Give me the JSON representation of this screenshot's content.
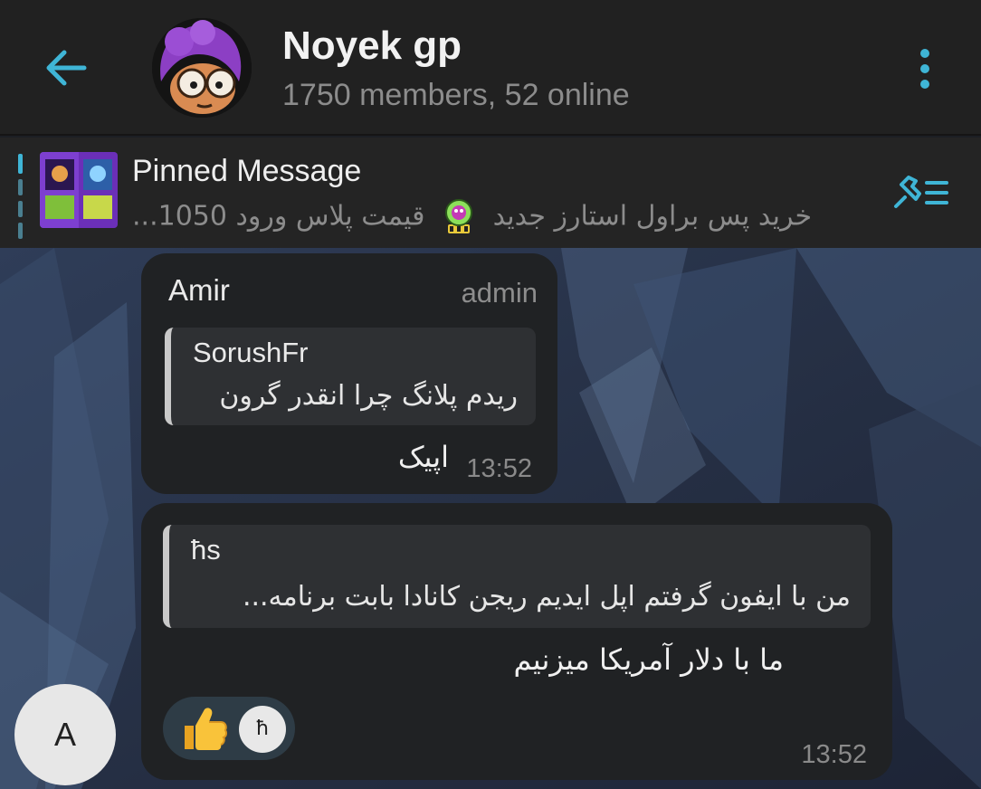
{
  "header": {
    "title": "Noyek gp",
    "subtitle": "1750 members, 52 online",
    "back_icon": "arrow-left-icon",
    "menu_icon": "more-vertical-icon",
    "accent_color": "#3fb5d6"
  },
  "pinned": {
    "title": "Pinned Message",
    "preview_text": "خرید پس براول استارز جدید",
    "preview_price": "قیمت پلاس ورود 1050...",
    "list_icon": "pinned-list-icon"
  },
  "messages": [
    {
      "sender": "Amir",
      "role": "admin",
      "reply_to": {
        "name": "SorushFr",
        "text": "ریدم پلانگ چرا انقدر گرون"
      },
      "text": "اپیک",
      "time": "13:52"
    },
    {
      "reply_to": {
        "name": "ħs",
        "text": "من با ایفون گرفتم اپل ایدیم ریجن کانادا بابت برنامه..."
      },
      "text": "ما با دلار آمریکا میزنیم",
      "reaction": {
        "emoji": "thumbs-up-icon",
        "avatar_letter": "ħ"
      },
      "time": "13:52"
    }
  ],
  "user_avatar_letter": "A"
}
